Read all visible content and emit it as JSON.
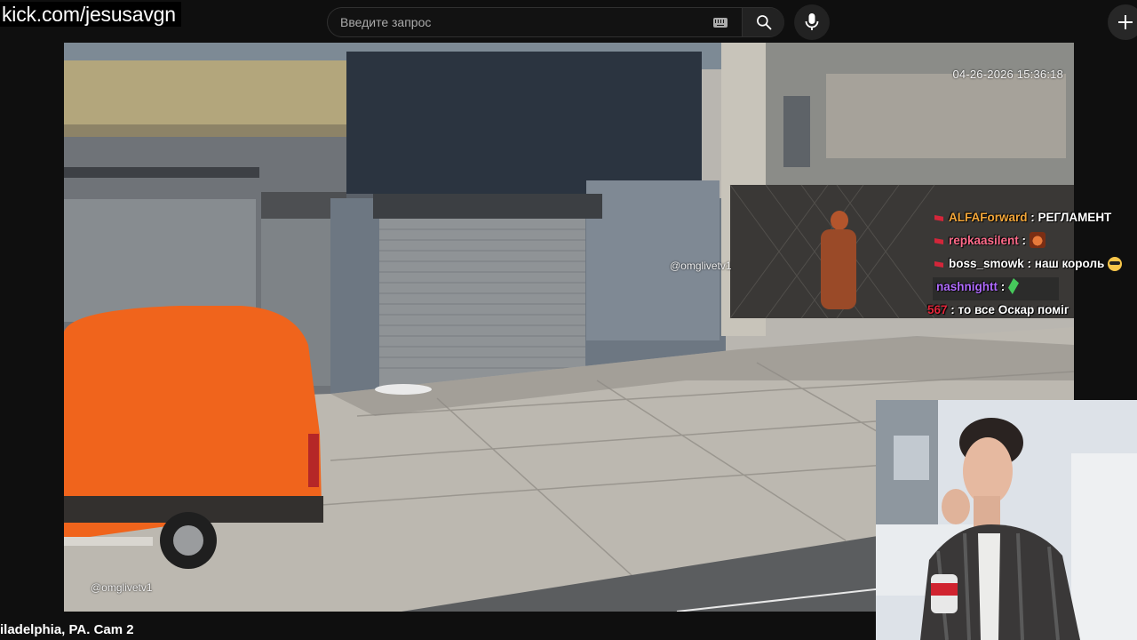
{
  "overlay": {
    "channel_url": "kick.com/jesusavgn",
    "location_caption": "iladelphia, PA. Cam 2"
  },
  "header": {
    "search": {
      "placeholder": "Введите запрос",
      "value": ""
    },
    "icons": [
      "keyboard-icon",
      "search-icon",
      "microphone-icon",
      "plus-icon"
    ]
  },
  "stream": {
    "timestamp": "04-26-2026 15:36:18",
    "watermark_top": "@omglivetv1",
    "watermark_bottom": "@omglivetv1"
  },
  "chat": {
    "messages": [
      {
        "user": "ALFAForward",
        "user_color": "#f4a73a",
        "text": "РЕГЛАМЕНТ",
        "emote": ""
      },
      {
        "user": "repkaasilent",
        "user_color": "#ff6b8a",
        "text": "",
        "emote": "bear-emote"
      },
      {
        "user": "boss_smowk",
        "user_color": "#ffffff",
        "text": "наш король",
        "emote": "sunglasses-emote"
      },
      {
        "user": "nashnightt",
        "user_color": "#b06bff",
        "text": "",
        "emote": "feather-emote"
      },
      {
        "user": "567",
        "user_color": "#e2263a",
        "text": "то все Оскар поміг",
        "emote": ""
      }
    ],
    "separator": " : "
  },
  "colors": {
    "background": "#0f0f0f",
    "van": "#f0641c",
    "sidewalk": "#b9b6b0",
    "shutter": "#8f9396"
  }
}
